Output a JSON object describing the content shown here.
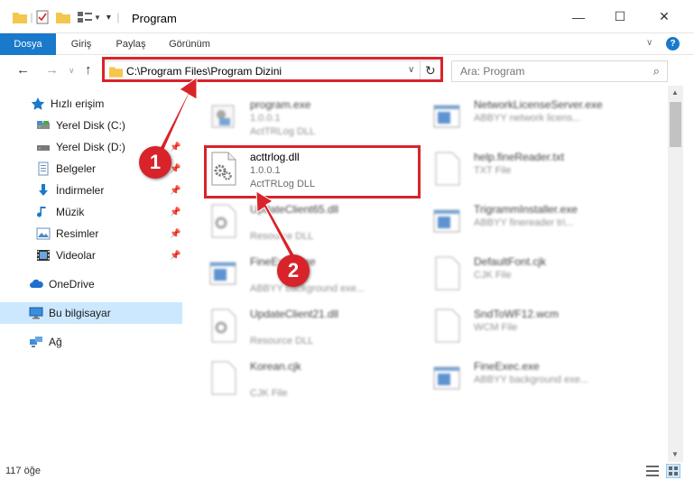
{
  "window": {
    "title": "Program",
    "minimize_glyph": "—",
    "maximize_glyph": "☐",
    "close_glyph": "✕"
  },
  "ribbon": {
    "tabs": [
      {
        "label": "Dosya",
        "active": true
      },
      {
        "label": "Giriş",
        "active": false
      },
      {
        "label": "Paylaş",
        "active": false
      },
      {
        "label": "Görünüm",
        "active": false
      }
    ]
  },
  "nav": {
    "back": "←",
    "forward": "→",
    "recent": "∨",
    "up": "↑",
    "address": "C:\\Program Files\\Program Dizini",
    "refresh": "↻",
    "search_placeholder": "Ara: Program"
  },
  "sidebar": {
    "items": [
      {
        "label": "Hızlı erişim",
        "icon": "star-icon",
        "pinned": false
      },
      {
        "label": "Yerel Disk (C:)",
        "icon": "drive-icon",
        "pinned": false
      },
      {
        "label": "Yerel Disk (D:)",
        "icon": "drive-icon",
        "pinned": true
      },
      {
        "label": "Belgeler",
        "icon": "documents-icon",
        "pinned": true
      },
      {
        "label": "İndirmeler",
        "icon": "download-icon",
        "pinned": true
      },
      {
        "label": "Müzik",
        "icon": "music-icon",
        "pinned": true
      },
      {
        "label": "Resimler",
        "icon": "pictures-icon",
        "pinned": true
      },
      {
        "label": "Videolar",
        "icon": "videos-icon",
        "pinned": true
      },
      {
        "label": "OneDrive",
        "icon": "cloud-icon",
        "pinned": false
      },
      {
        "label": "Bu bilgisayar",
        "icon": "computer-icon",
        "pinned": false,
        "selected": true
      },
      {
        "label": "Ağ",
        "icon": "network-icon",
        "pinned": false
      }
    ]
  },
  "files": {
    "left": [
      {
        "name": "program.exe",
        "version": "1.0.0.1",
        "description": "ActTRLog DLL",
        "kind": "exe",
        "blurred": true
      },
      {
        "name": "acttrlog.dll",
        "version": "1.0.0.1",
        "description": "ActTRLog DLL",
        "kind": "dll",
        "blurred": false
      },
      {
        "name": "UpdateClient65.dll",
        "version": "",
        "description": "Resource DLL",
        "kind": "dll",
        "blurred": true
      },
      {
        "name": "FineExec.exe",
        "version": "",
        "description": "ABBYY background exe...",
        "kind": "app",
        "blurred": true
      },
      {
        "name": "UpdateClient21.dll",
        "version": "",
        "description": "Resource DLL",
        "kind": "dll",
        "blurred": true
      },
      {
        "name": "Korean.cjk",
        "version": "",
        "description": "CJK File",
        "kind": "doc",
        "blurred": true
      }
    ],
    "right": [
      {
        "name": "NetworkLicenseServer.exe",
        "version": "",
        "description": "ABBYY network licens...",
        "kind": "app",
        "blurred": true
      },
      {
        "name": "help.fineReader.txt",
        "version": "",
        "description": "TXT File",
        "kind": "doc",
        "blurred": true
      },
      {
        "name": "TrigrammInstaller.exe",
        "version": "",
        "description": "ABBYY finereader tri...",
        "kind": "app",
        "blurred": true
      },
      {
        "name": "DefaultFont.cjk",
        "version": "",
        "description": "CJK File",
        "kind": "doc",
        "blurred": true
      },
      {
        "name": "SndToWF12.wcm",
        "version": "",
        "description": "WCM File",
        "kind": "doc",
        "blurred": true
      },
      {
        "name": "FineExec.exe",
        "version": "",
        "description": "ABBYY background exe...",
        "kind": "app",
        "blurred": true
      }
    ]
  },
  "status": {
    "item_count": "117 öğe"
  },
  "annotations": {
    "badge1": "1",
    "badge2": "2",
    "color": "#d9232a"
  }
}
